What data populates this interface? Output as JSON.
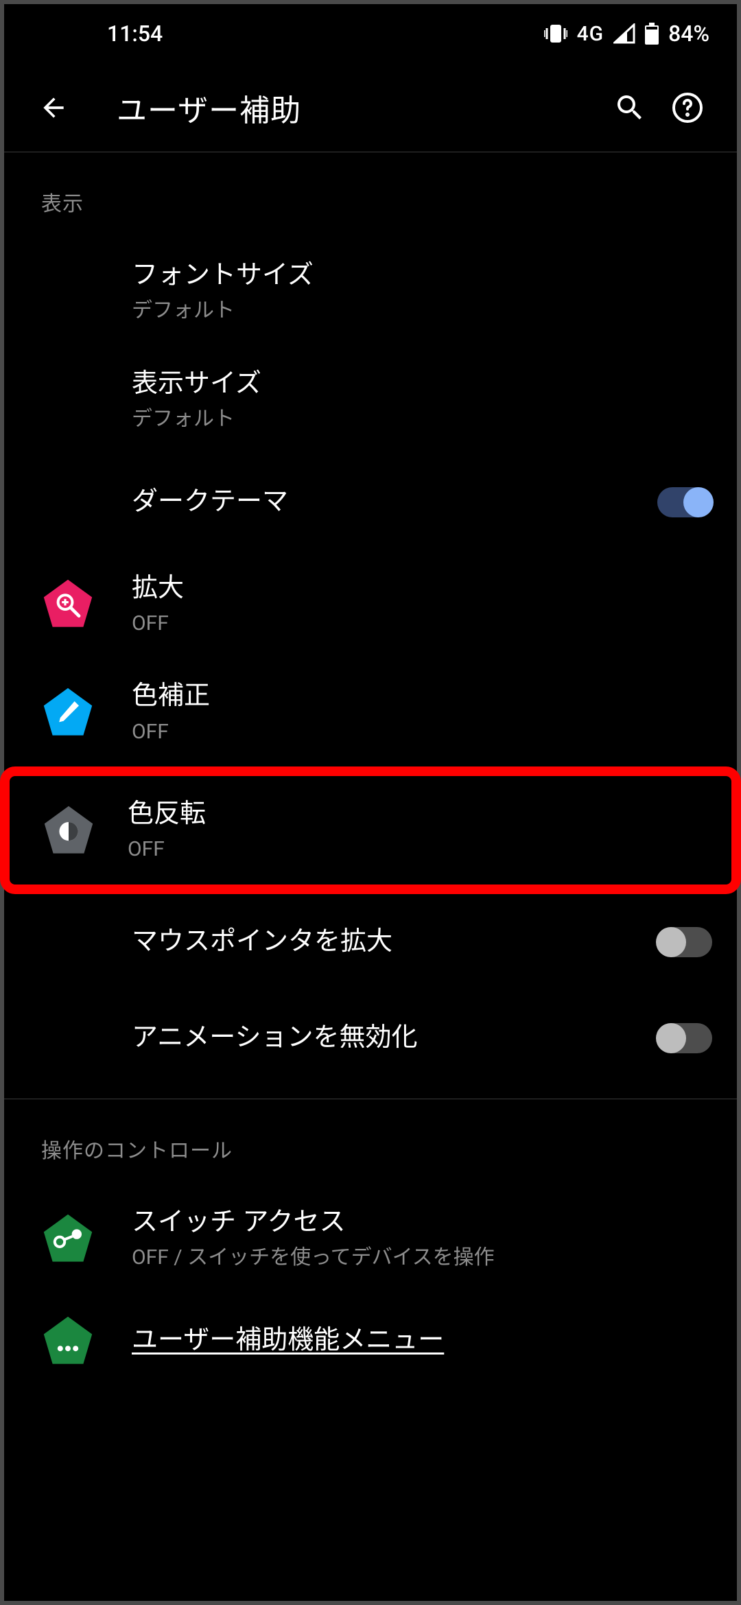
{
  "status": {
    "time": "11:54",
    "network": "4G",
    "battery": "84%"
  },
  "appbar": {
    "title": "ユーザー補助"
  },
  "section1": {
    "header": "表示",
    "items": [
      {
        "title": "フォントサイズ",
        "sub": "デフォルト"
      },
      {
        "title": "表示サイズ",
        "sub": "デフォルト"
      },
      {
        "title": "ダークテーマ"
      },
      {
        "title": "拡大",
        "sub": "OFF"
      },
      {
        "title": "色補正",
        "sub": "OFF"
      },
      {
        "title": "色反転",
        "sub": "OFF"
      },
      {
        "title": "マウスポインタを拡大"
      },
      {
        "title": "アニメーションを無効化"
      }
    ]
  },
  "section2": {
    "header": "操作のコントロール",
    "items": [
      {
        "title": "スイッチ アクセス",
        "sub": "OFF / スイッチを使ってデバイスを操作"
      },
      {
        "title": "ユーザー補助機能メニュー"
      }
    ]
  }
}
